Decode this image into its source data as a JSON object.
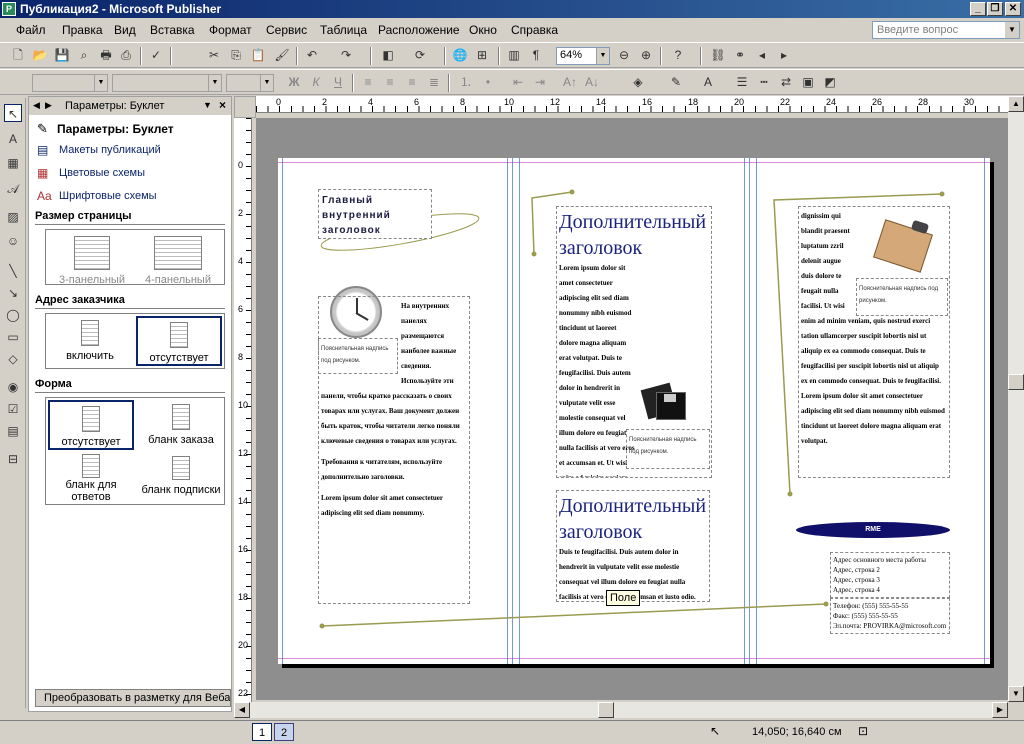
{
  "window": {
    "title": "Публикация2 - Microsoft Publisher",
    "icon_letter": "P"
  },
  "menu": [
    "Файл",
    "Правка",
    "Вид",
    "Вставка",
    "Формат",
    "Сервис",
    "Таблица",
    "Расположение",
    "Окно",
    "Справка"
  ],
  "help_placeholder": "Введите вопрос",
  "toolbar": {
    "zoom": "64%"
  },
  "task_pane": {
    "title": "Параметры: Буклет",
    "heading": "Параметры: Буклет",
    "links": [
      "Макеты публикаций",
      "Цветовые схемы",
      "Шрифтовые схемы"
    ],
    "sections": {
      "page_size": {
        "label": "Размер страницы",
        "options": [
          "3-панельный",
          "4-панельный"
        ]
      },
      "customer_address": {
        "label": "Адрес заказчика",
        "options": [
          "включить",
          "отсутствует"
        ],
        "selected": "отсутствует"
      },
      "form": {
        "label": "Форма",
        "options": [
          "отсутствует",
          "бланк заказа",
          "бланк для ответов",
          "бланк подписки"
        ],
        "selected": "отсутствует"
      }
    },
    "convert_button": "Преобразовать в разметку для Веба"
  },
  "rulers": {
    "horizontal": [
      "0",
      "2",
      "4",
      "6",
      "8",
      "10",
      "12",
      "14",
      "16",
      "18",
      "20",
      "22",
      "24",
      "26",
      "28",
      "30"
    ],
    "vertical": [
      "0",
      "2",
      "4",
      "6",
      "8",
      "10",
      "12",
      "14",
      "16",
      "18",
      "20",
      "22"
    ]
  },
  "brochure": {
    "panel1": {
      "heading": "Главный внутренний заголовок",
      "caption": "Пояснительная надпись под рисунком.",
      "body1": "На внутренних панелях размещаются наиболее важные сведения. Используйте эти панели, чтобы кратко рассказать о своих товарах или услугах. Ваш документ должен быть краток, чтобы читатели легко поняли ключевые сведения о товарах или услугах.",
      "body2": "Требования к читателям, используйте дополнительно заголовки.",
      "body3": "Lorem ipsum dolor sit amet consectetuer adipiscing elit sed diam nonummy."
    },
    "panel2": {
      "heading1": "Дополнительный заголовок",
      "body1": "Lorem ipsum dolor sit amet consectetuer adipiscing elit sed diam nonummy nibh euismod tincidunt ut laoreet dolore magna aliquam erat volutpat. Duis te feugifacilisi. Duis autem dolor in hendrerit in vulputate velit esse molestie consequat vel illum dolore eu feugiat nulla facilisis at vero eros et accumsan et. Ut wisi enim ad minim veniam, quis nostrud exercitation ullamcorper suscipit lobortis nisl ut aliquip ex ea commodo consequat.",
      "caption": "Пояснительная надпись под рисунком.",
      "heading2": "Дополнительный заголовок",
      "body2": "Duis te feugifacilisi. Duis autem dolor in hendrerit in vulputate velit esse molestie consequat vel illum dolore eu feugiat nulla facilisis at vero eros et accumsan et iusto odio."
    },
    "panel3": {
      "body": "dignissim qui blandit praesent luptatum zzril delenit augue duis dolore te feugait nulla facilisi. Ut wisi enim ad minim veniam, quis nostrud exerci tation ullamcorper suscipit lobortis nisl ut aliquip ex ea commodo consequat. Duis te feugifacilisi per suscipit lobortis nisl ut aliquip ex en commodo consequat. Duis te feugifacilisi. Lorem ipsum dolor sit amet consectetuer adipiscing elit sed diam nonummy nibh euismod tincidunt ut laoreet dolore magna aliquam erat volutpat.",
      "caption": "Пояснительная надпись под рисунком.",
      "logo": "RME",
      "address": [
        "Адрес основного места работы",
        "Адрес, строка 2",
        "Адрес, строка 3",
        "Адрес, строка 4"
      ],
      "contacts": [
        "Телефон: (555) 555-55-55",
        "Факс: (555) 555-55-55",
        "Эл.почта: PROVIRKA@microsoft.com"
      ]
    }
  },
  "tooltip": "Поле",
  "status": {
    "pages": [
      "1",
      "2"
    ],
    "coords": "14,050; 16,640 см"
  }
}
